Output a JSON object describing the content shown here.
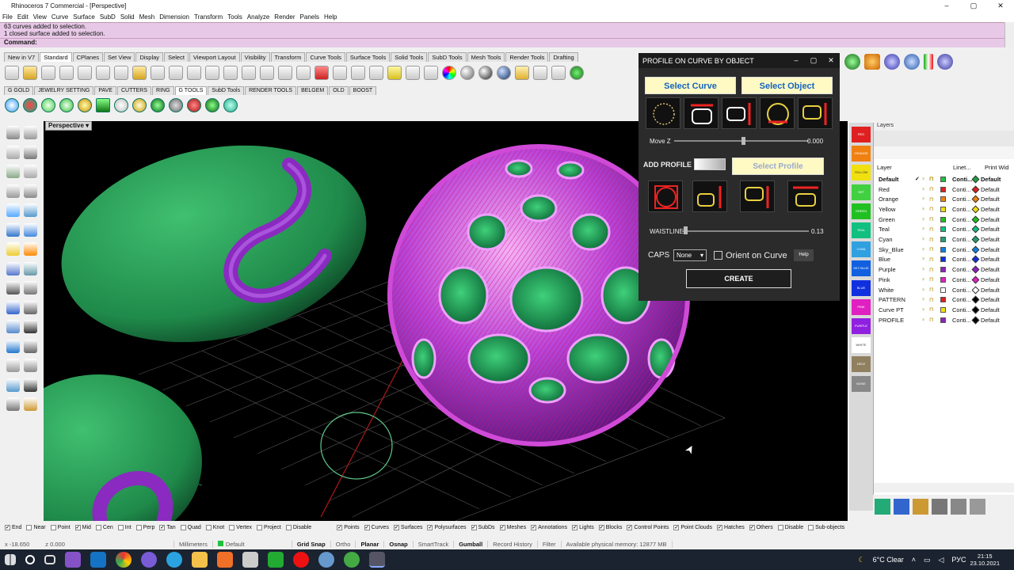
{
  "window": {
    "title": "Rhinoceros 7 Commercial - [Perspective]",
    "min": "–",
    "max": "▢",
    "close": "✕"
  },
  "menu": [
    "File",
    "Edit",
    "View",
    "Curve",
    "Surface",
    "SubD",
    "Solid",
    "Mesh",
    "Dimension",
    "Transform",
    "Tools",
    "Analyze",
    "Render",
    "Panels",
    "Help"
  ],
  "command": {
    "history": [
      "63 curves added to selection.",
      "1 closed surface added to selection."
    ],
    "prompt": "Command:"
  },
  "toolbar_tabs": [
    "New in V7",
    "Standard",
    "CPlanes",
    "Set View",
    "Display",
    "Select",
    "Viewport Layout",
    "Visibility",
    "Transform",
    "Curve Tools",
    "Surface Tools",
    "Solid Tools",
    "SubD Tools",
    "Mesh Tools",
    "Render Tools",
    "Drafting"
  ],
  "toolbar_tabs_active": "Standard",
  "toolbar2_tabs": [
    "G GOLD",
    "JEWELRY SETTING",
    "PAVE",
    "CUTTERS",
    "RING",
    "G TOOLS",
    "SubD Tools",
    "RENDER TOOLS",
    "BELGEM",
    "OLD",
    "BOOST"
  ],
  "toolbar2_active": "G TOOLS",
  "viewport": {
    "label": "Perspective",
    "dropdown": "▾",
    "cursor": "➤"
  },
  "dialog": {
    "title": "PROFILE ON CURVE BY OBJECT",
    "select_curve": "Select Curve",
    "select_object": "Select Object",
    "move_z_label": "Move Z",
    "move_z_value": "0.000",
    "move_z_level": 0.5,
    "add_profile_label": "ADD PROFILE",
    "select_profile": "Select Profile",
    "waistline_label": "WAISTLINE",
    "waistline_value": "0.13",
    "waistline_level": 0.13,
    "caps_label": "CAPS",
    "caps_value": "None",
    "orient_label": "Orient on Curve",
    "help": "Help",
    "create": "CREATE"
  },
  "color_strip": [
    {
      "label": "RED",
      "color": "#e02020"
    },
    {
      "label": "ORANGE",
      "color": "#f08010"
    },
    {
      "label": "YELLOW",
      "color": "#f0e010"
    },
    {
      "label": "SET",
      "color": "#40d040"
    },
    {
      "label": "GREEN",
      "color": "#20c020"
    },
    {
      "label": "TEAL",
      "color": "#10c080"
    },
    {
      "label": "CYAN",
      "color": "#30a0e0"
    },
    {
      "label": "SKY BLUE",
      "color": "#1060e0"
    },
    {
      "label": "BLUE",
      "color": "#1030e0"
    },
    {
      "label": "PINK",
      "color": "#e020c0"
    },
    {
      "label": "PURPLE",
      "color": "#9020e0"
    },
    {
      "label": "WHITE",
      "color": "#ffffff"
    },
    {
      "label": "DELE",
      "color": "#908060"
    },
    {
      "label": "NONE",
      "color": "#888888"
    }
  ],
  "layers": {
    "panel_title": "Layers",
    "col_layer": "Layer",
    "col_linetype": "Linet...",
    "col_printwidth": "Print Wid",
    "rows": [
      {
        "name": "Default",
        "check": "✓",
        "color": "#20c040",
        "linetype": "Conti...",
        "print": "Default",
        "pcolor": "#20a040",
        "bold": true
      },
      {
        "name": "Red",
        "check": "",
        "color": "#e02020",
        "linetype": "Conti...",
        "print": "Default",
        "pcolor": "#e02020",
        "bold": false
      },
      {
        "name": "Orange",
        "check": "",
        "color": "#f08010",
        "linetype": "Conti...",
        "print": "Default",
        "pcolor": "#f08010",
        "bold": false
      },
      {
        "name": "Yellow",
        "check": "",
        "color": "#f0e010",
        "linetype": "Conti...",
        "print": "Default",
        "pcolor": "#f0e010",
        "bold": false
      },
      {
        "name": "Green",
        "check": "",
        "color": "#20c020",
        "linetype": "Conti...",
        "print": "Default",
        "pcolor": "#20c020",
        "bold": false
      },
      {
        "name": "Teal",
        "check": "",
        "color": "#10c080",
        "linetype": "Conti...",
        "print": "Default",
        "pcolor": "#10c080",
        "bold": false
      },
      {
        "name": "Cyan",
        "check": "",
        "color": "#20a070",
        "linetype": "Conti...",
        "print": "Default",
        "pcolor": "#20a070",
        "bold": false
      },
      {
        "name": "Sky_Blue",
        "check": "",
        "color": "#1080e0",
        "linetype": "Conti...",
        "print": "Default",
        "pcolor": "#1080e0",
        "bold": false
      },
      {
        "name": "Blue",
        "check": "",
        "color": "#1030e0",
        "linetype": "Conti...",
        "print": "Default",
        "pcolor": "#1030e0",
        "bold": false
      },
      {
        "name": "Purple",
        "check": "",
        "color": "#9020c0",
        "linetype": "Conti...",
        "print": "Default",
        "pcolor": "#9020c0",
        "bold": false
      },
      {
        "name": "Pink",
        "check": "",
        "color": "#e020c0",
        "linetype": "Conti...",
        "print": "Default",
        "pcolor": "#e020c0",
        "bold": false
      },
      {
        "name": "White",
        "check": "",
        "color": "#ffffff",
        "linetype": "Conti...",
        "print": "Default",
        "pcolor": "#ffffff",
        "bold": false
      },
      {
        "name": "PATTERN",
        "check": "",
        "color": "#e02020",
        "linetype": "Conti...",
        "print": "Default",
        "pcolor": "#000000",
        "bold": false
      },
      {
        "name": "Curve PT",
        "check": "",
        "color": "#f0e010",
        "linetype": "Conti...",
        "print": "Default",
        "pcolor": "#000000",
        "bold": false
      },
      {
        "name": "PROFILE",
        "check": "",
        "color": "#9020c0",
        "linetype": "Conti...",
        "print": "Default",
        "pcolor": "#000000",
        "bold": false
      }
    ]
  },
  "snaps": [
    "End",
    "Near",
    "Point",
    "Mid",
    "Cen",
    "Int",
    "Perp",
    "Tan",
    "Quad",
    "Knot",
    "Vertex",
    "Project",
    "Disable"
  ],
  "snaps_checked": [
    true,
    false,
    false,
    true,
    false,
    false,
    false,
    true,
    false,
    false,
    false,
    false,
    false
  ],
  "filters": [
    "Points",
    "Curves",
    "Surfaces",
    "Polysurfaces",
    "SubDs",
    "Meshes",
    "Annotations",
    "Lights",
    "Blocks",
    "Control Points",
    "Point Clouds",
    "Hatches",
    "Others",
    "Disable",
    "Sub-objects"
  ],
  "status": {
    "x": "x -18.650",
    "z": "z 0.000",
    "units": "Millimeters",
    "layer": "Default",
    "grid_snap": "Grid Snap",
    "ortho": "Ortho",
    "planar": "Planar",
    "osnap": "Osnap",
    "smarttrack": "SmartTrack",
    "gumball": "Gumball",
    "record": "Record History",
    "filter": "Filter",
    "memory": "Available physical memory: 12877 MB"
  },
  "taskbar": {
    "weather": "6°C  Clear",
    "lang": "РУС",
    "time": "21:15",
    "date": "23.10.2021"
  }
}
